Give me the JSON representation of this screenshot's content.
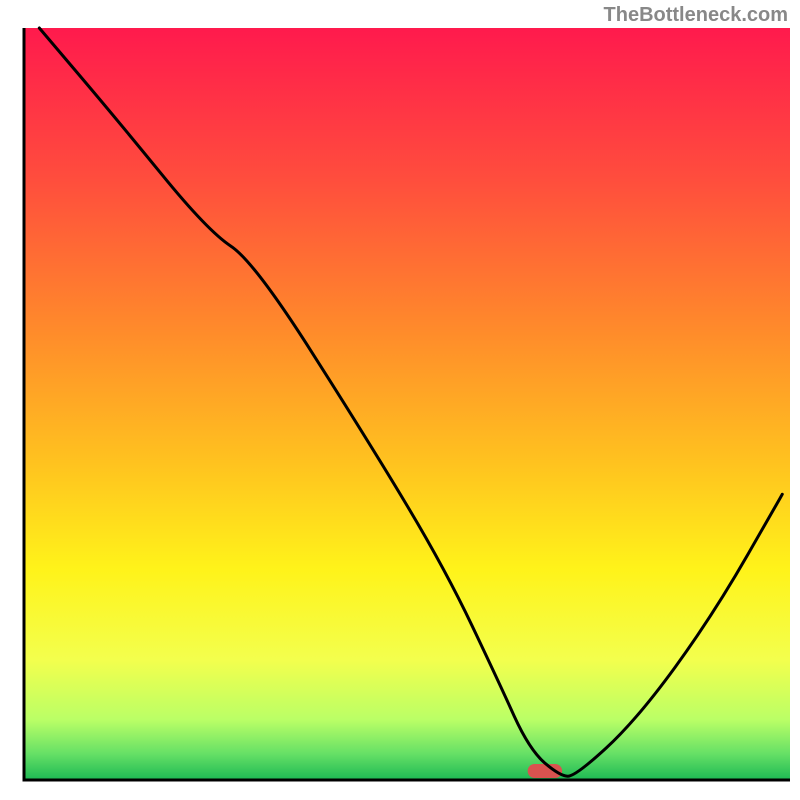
{
  "watermark": "TheBottleneck.com",
  "chart_data": {
    "type": "line",
    "title": "",
    "xlabel": "",
    "ylabel": "",
    "x_range": [
      0,
      100
    ],
    "y_range": [
      0,
      100
    ],
    "notes": "Performance bottleneck curve over a red-to-green vertical gradient. Black curve descends from top-left, has a slight break in slope around one-third across, reaches a flat minimum near two-thirds across (marked with a small red rounded bar at the bottom), then rises toward the right edge. Axes are drawn but unlabeled.",
    "series": [
      {
        "name": "curve",
        "x": [
          2,
          12,
          24,
          30,
          45,
          55,
          62,
          66,
          70,
          72,
          80,
          90,
          99
        ],
        "y": [
          100,
          88,
          73,
          69,
          45,
          28,
          13,
          4,
          0.5,
          0.5,
          8,
          22,
          38
        ]
      }
    ],
    "minimum_marker": {
      "x": 68,
      "y": 0.2,
      "width": 4.5,
      "color": "#d9534f"
    },
    "gradient_stops": [
      {
        "offset": 0.0,
        "color": "#ff1a4d"
      },
      {
        "offset": 0.2,
        "color": "#ff4d3d"
      },
      {
        "offset": 0.4,
        "color": "#ff8a2b"
      },
      {
        "offset": 0.58,
        "color": "#ffc31f"
      },
      {
        "offset": 0.72,
        "color": "#fff31a"
      },
      {
        "offset": 0.84,
        "color": "#f3ff4d"
      },
      {
        "offset": 0.92,
        "color": "#baff66"
      },
      {
        "offset": 0.965,
        "color": "#66e066"
      },
      {
        "offset": 1.0,
        "color": "#1db954"
      }
    ],
    "axis": {
      "color": "#000000",
      "width": 3
    },
    "curve_style": {
      "color": "#000000",
      "width": 3
    }
  }
}
